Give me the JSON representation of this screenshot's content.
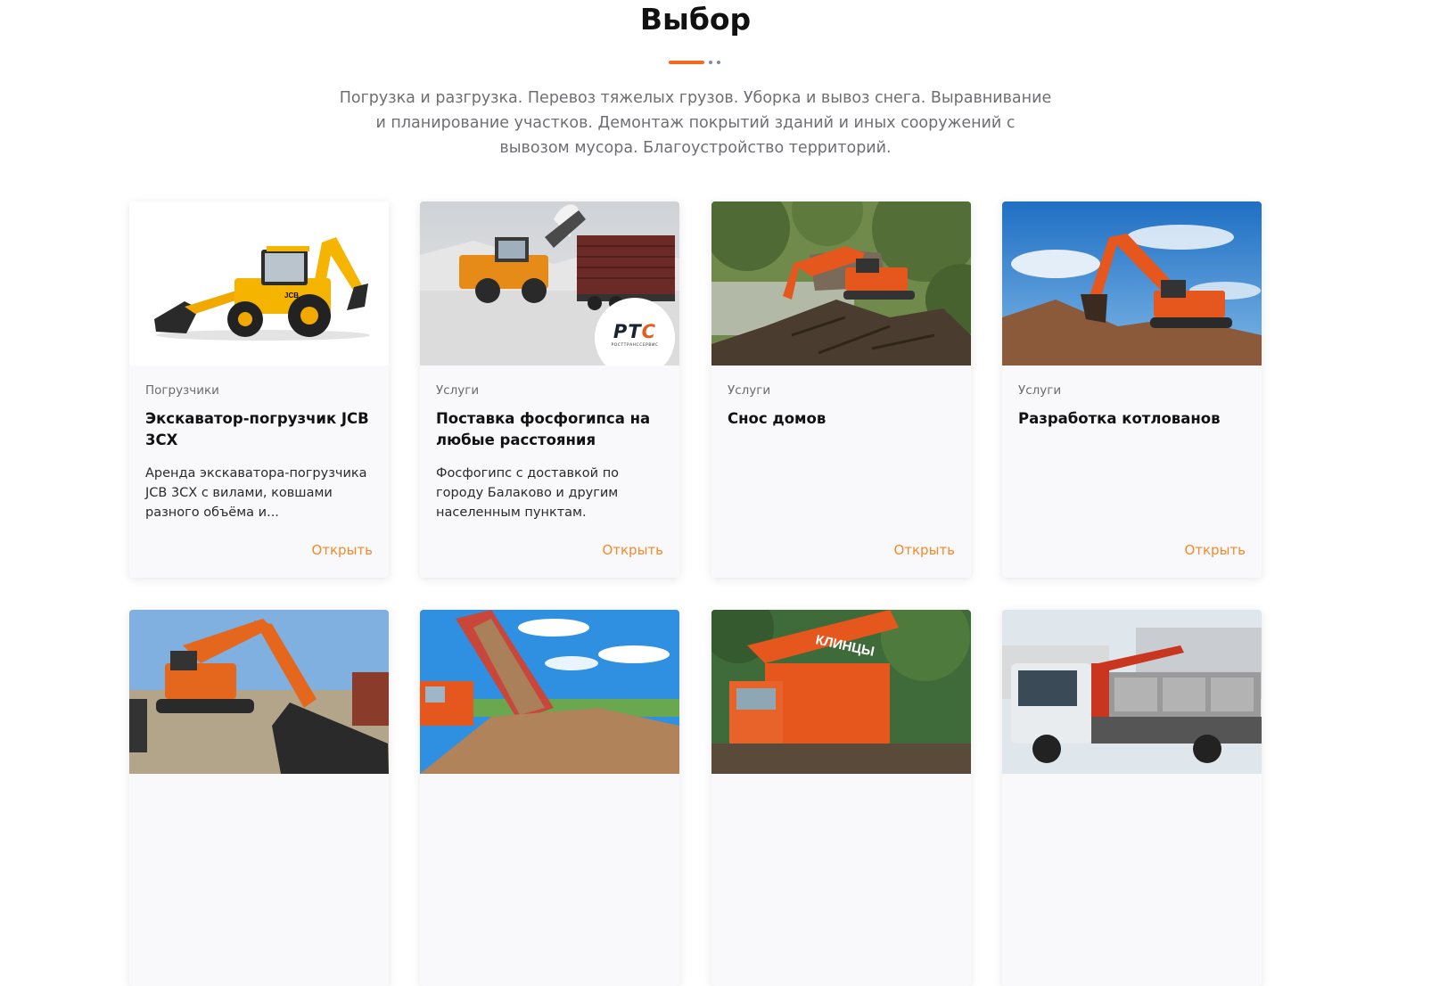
{
  "section": {
    "title": "Выбор",
    "intro": "Погрузка и разгрузка. Перевоз тяжелых грузов. Уборка и вывоз снега. Выравнивание и планирование участков. Демонтаж покрытий зданий и иных сооружений с вывозом мусора. Благоустройство территорий."
  },
  "colors": {
    "accent": "#f26b21",
    "link": "#f28a2c",
    "deco_dot": "#7b8ab0"
  },
  "cards": [
    {
      "category": "Погрузчики",
      "title": "Экскаватор-погрузчик JCB 3CX",
      "description": "Аренда экскаватора-погрузчика JCB 3CX с вилами, ковшами разного объёма и...",
      "open_label": "Открыть",
      "image": "backhoe-loader-photo"
    },
    {
      "category": "Услуги",
      "title": "Поставка фосфогипса на любые расстояния",
      "description": "Фосфогипс с доставкой по городу Балаково и другим населенным пунктам.",
      "open_label": "Открыть",
      "image": "wheel-loader-photo",
      "badge": {
        "logo_main": "РТ",
        "logo_accent": "С",
        "logo_sub": "РОСТТРАНССЕРВИС"
      }
    },
    {
      "category": "Услуги",
      "title": "Снос домов",
      "description": "",
      "open_label": "Открыть",
      "image": "demolition-excavator-photo"
    },
    {
      "category": "Услуги",
      "title": "Разработка котлованов",
      "description": "",
      "open_label": "Открыть",
      "image": "digging-excavator-photo"
    },
    {
      "image": "excavator-yard-photo"
    },
    {
      "image": "dump-truck-photo"
    },
    {
      "image": "truck-crane-photo",
      "sign": "КЛИНЦЫ"
    },
    {
      "image": "crane-truck-photo"
    }
  ]
}
